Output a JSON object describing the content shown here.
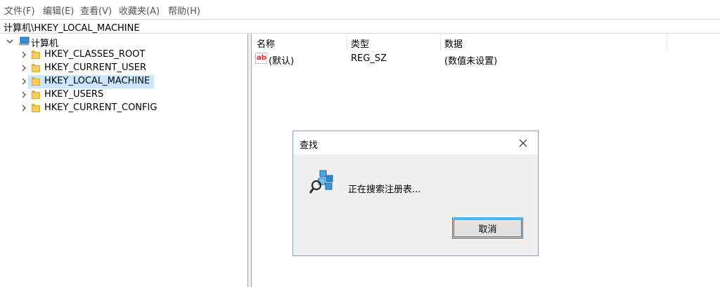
{
  "menu": [
    "文件(F)",
    "编辑(E)",
    "查看(V)",
    "收藏夹(A)",
    "帮助(H)"
  ],
  "address": "计算机\\HKEY_LOCAL_MACHINE",
  "tree": {
    "root": "计算机",
    "items": [
      {
        "label": "HKEY_CLASSES_ROOT",
        "selected": false
      },
      {
        "label": "HKEY_CURRENT_USER",
        "selected": false
      },
      {
        "label": "HKEY_LOCAL_MACHINE",
        "selected": true
      },
      {
        "label": "HKEY_USERS",
        "selected": false
      },
      {
        "label": "HKEY_CURRENT_CONFIG",
        "selected": false
      }
    ]
  },
  "list": {
    "columns": [
      "名称",
      "类型",
      "数据"
    ],
    "rows": [
      {
        "icon": "string-value-icon",
        "icon_text": "ab",
        "name": "(默认)",
        "type": "REG_SZ",
        "data": "(数值未设置)"
      }
    ]
  },
  "dialog": {
    "title": "查找",
    "message": "正在搜索注册表...",
    "cancel_label": "取消",
    "icon": "registry-search-icon"
  },
  "colors": {
    "selection": "#cce8ff",
    "accent": "#0078d7",
    "folder": "#f5ce5a"
  }
}
